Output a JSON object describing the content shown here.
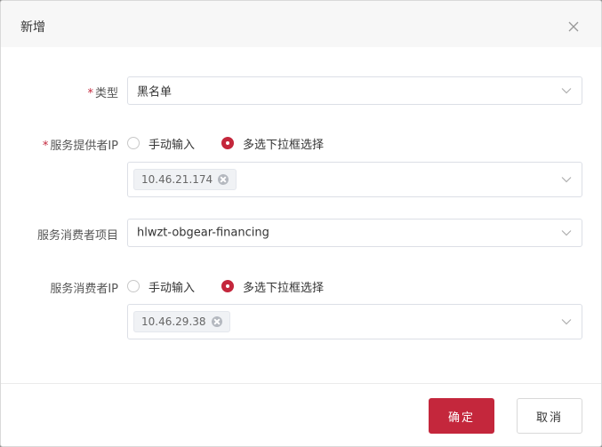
{
  "dialog": {
    "title": "新增",
    "close_icon": "close-icon"
  },
  "form": {
    "type": {
      "required_mark": "*",
      "label": "类型",
      "value": "黑名单"
    },
    "provider_ip": {
      "required_mark": "*",
      "label": "服务提供者IP",
      "radio_manual": "手动输入",
      "radio_dropdown": "多选下拉框选择",
      "selected_option": "多选下拉框选择",
      "tags": [
        "10.46.21.174"
      ]
    },
    "consumer_project": {
      "label": "服务消费者项目",
      "value": "hlwzt-obgear-financing"
    },
    "consumer_ip": {
      "label": "服务消费者IP",
      "radio_manual": "手动输入",
      "radio_dropdown": "多选下拉框选择",
      "selected_option": "多选下拉框选择",
      "tags": [
        "10.46.29.38"
      ]
    }
  },
  "footer": {
    "confirm_label": "确定",
    "cancel_label": "取消"
  },
  "colors": {
    "accent": "#c4273c",
    "header_bg": "#f7f7f7",
    "border": "#dcdfe6"
  }
}
